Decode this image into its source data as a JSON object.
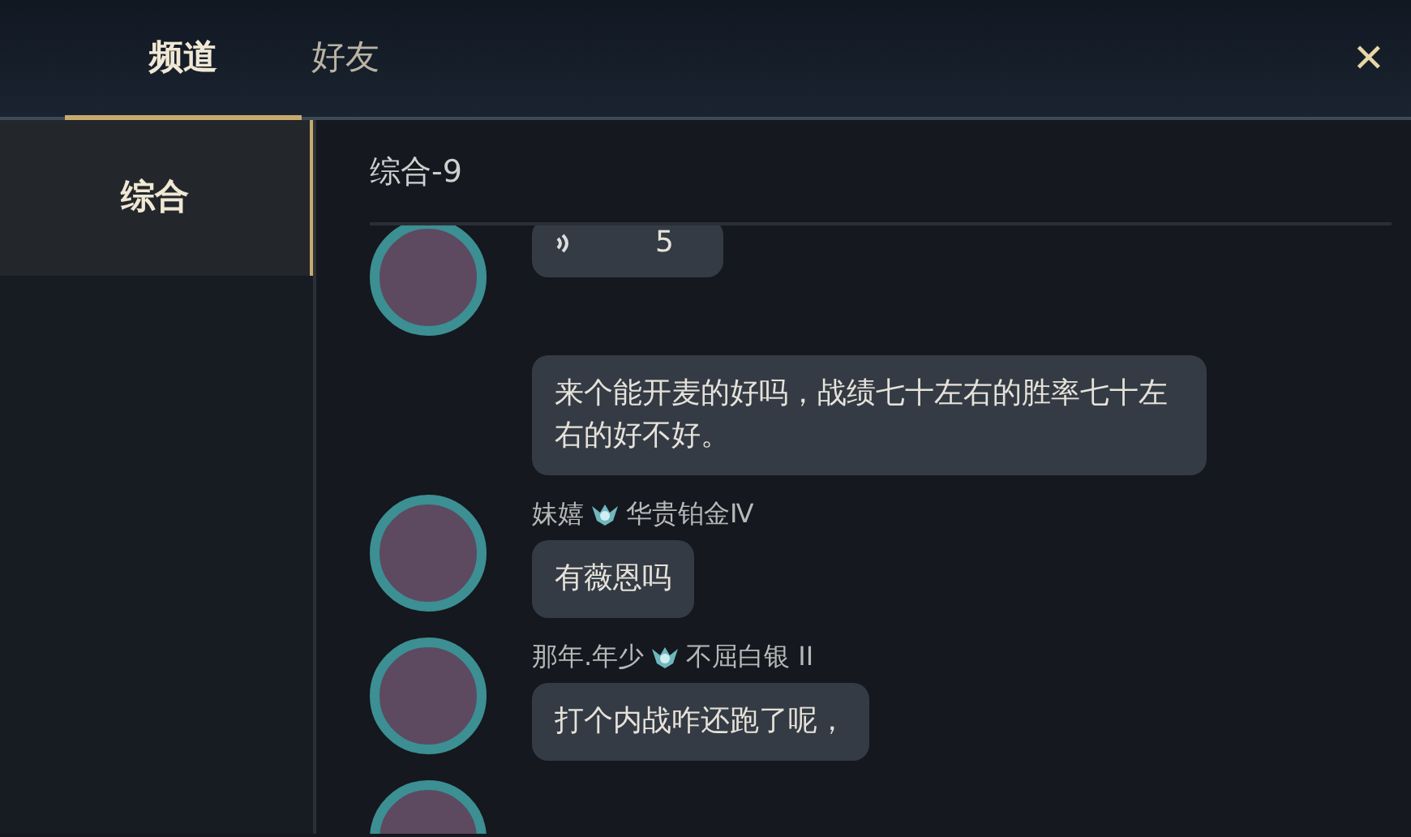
{
  "tabs": [
    {
      "label": "频道",
      "selected": true
    },
    {
      "label": "好友",
      "selected": false
    }
  ],
  "close": "✕",
  "sidebar": {
    "items": [
      {
        "label": "综合",
        "selected": true
      }
    ]
  },
  "channel": {
    "title": "综合-9"
  },
  "messages": [
    {
      "avatar": true,
      "kind": "voice",
      "duration": "5"
    },
    {
      "avatar": false,
      "kind": "text",
      "text": "来个能开麦的好吗，战绩七十左右的胜率七十左右的好不好。"
    },
    {
      "avatar": true,
      "name": "妹嬉",
      "rank": "华贵铂金Ⅳ",
      "kind": "text",
      "text": "有薇恩吗"
    },
    {
      "avatar": true,
      "name": "那年.年少",
      "rank": "不屈白银 II",
      "kind": "text",
      "text": "打个内战咋还跑了呢，"
    },
    {
      "avatar": true
    }
  ]
}
